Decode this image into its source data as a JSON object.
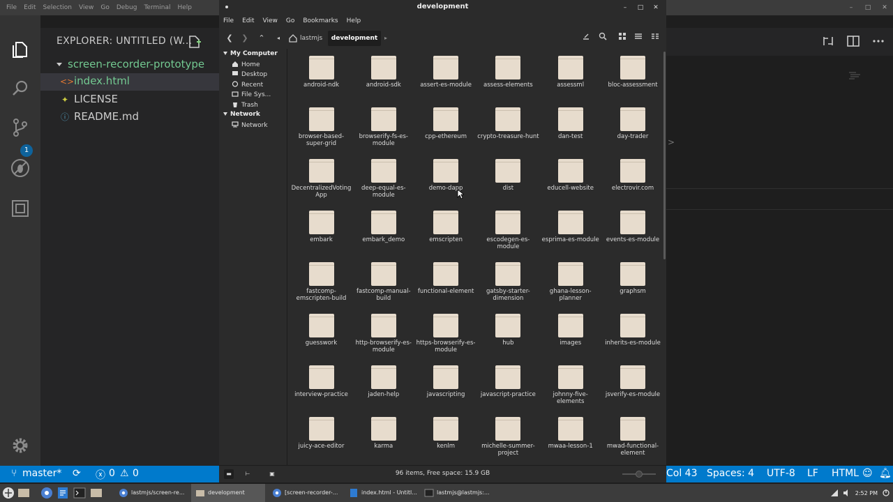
{
  "vscode": {
    "menu": [
      "File",
      "Edit",
      "Selection",
      "View",
      "Go",
      "Debug",
      "Terminal",
      "Help"
    ],
    "explorer_title": "EXPLORER: UNTITLED (W...",
    "folder_name": "screen-recorder-prototype",
    "files": [
      {
        "name": "index.html",
        "icon": "html-file-icon"
      },
      {
        "name": "LICENSE",
        "icon": "license-file-icon"
      },
      {
        "name": "README.md",
        "icon": "markdown-file-icon"
      }
    ],
    "scm_badge": "1",
    "statusbar": {
      "branch": "master*",
      "errors": "0",
      "warnings": "0",
      "position": "Col 43",
      "spaces": "Spaces: 4",
      "encoding": "UTF-8",
      "eol": "LF",
      "language": "HTML"
    }
  },
  "file_manager": {
    "title": "development",
    "menu": [
      "File",
      "Edit",
      "View",
      "Go",
      "Bookmarks",
      "Help"
    ],
    "breadcrumb": [
      "lastmjs",
      "development"
    ],
    "sidebar": {
      "sections": [
        {
          "title": "My Computer",
          "items": [
            "Home",
            "Desktop",
            "Recent",
            "File Sys...",
            "Trash"
          ]
        },
        {
          "title": "Network",
          "items": [
            "Network"
          ]
        }
      ]
    },
    "items": [
      "android-ndk",
      "android-sdk",
      "assert-es-module",
      "assess-elements",
      "assessml",
      "bloc-assessment",
      "browser-based-super-grid",
      "browserify-fs-es-module",
      "cpp-ethereum",
      "crypto-treasure-hunt",
      "dan-test",
      "day-trader",
      "DecentralizedVotingApp",
      "deep-equal-es-module",
      "demo-dapp",
      "dist",
      "educell-website",
      "electrovir.com",
      "embark",
      "embark_demo",
      "emscripten",
      "escodegen-es-module",
      "esprima-es-module",
      "events-es-module",
      "fastcomp-emscripten-build",
      "fastcomp-manual-build",
      "functional-element",
      "gatsby-starter-dimension",
      "ghana-lesson-planner",
      "graphsm",
      "guesswork",
      "http-browserify-es-module",
      "https-browserify-es-module",
      "hub",
      "images",
      "inherits-es-module",
      "interview-practice",
      "jaden-help",
      "javascripting",
      "javascript-practice",
      "johnny-five-elements",
      "jsverify-es-module",
      "juicy-ace-editor",
      "karma",
      "kenlm",
      "michelle-summer-project",
      "mwaa-lesson-1",
      "mwad-functional-element"
    ],
    "status": "96 items, Free space: 15.9 GB"
  },
  "taskbar": {
    "tasks": [
      {
        "label": "lastmjs/screen-re...",
        "icon": "chrome-icon"
      },
      {
        "label": "development",
        "icon": "folder-icon"
      },
      {
        "label": "[screen-recorder-...",
        "icon": "chrome-icon"
      },
      {
        "label": "index.html - Untitl...",
        "icon": "vscode-icon"
      },
      {
        "label": "lastmjs@lastmjs:...",
        "icon": "terminal-icon"
      }
    ],
    "clock": "2:52 PM"
  },
  "colors": {
    "vscode_bg": "#1e1e1e",
    "statusbar": "#007acc",
    "git_green": "#73c991",
    "folder": "#e7dccd"
  }
}
